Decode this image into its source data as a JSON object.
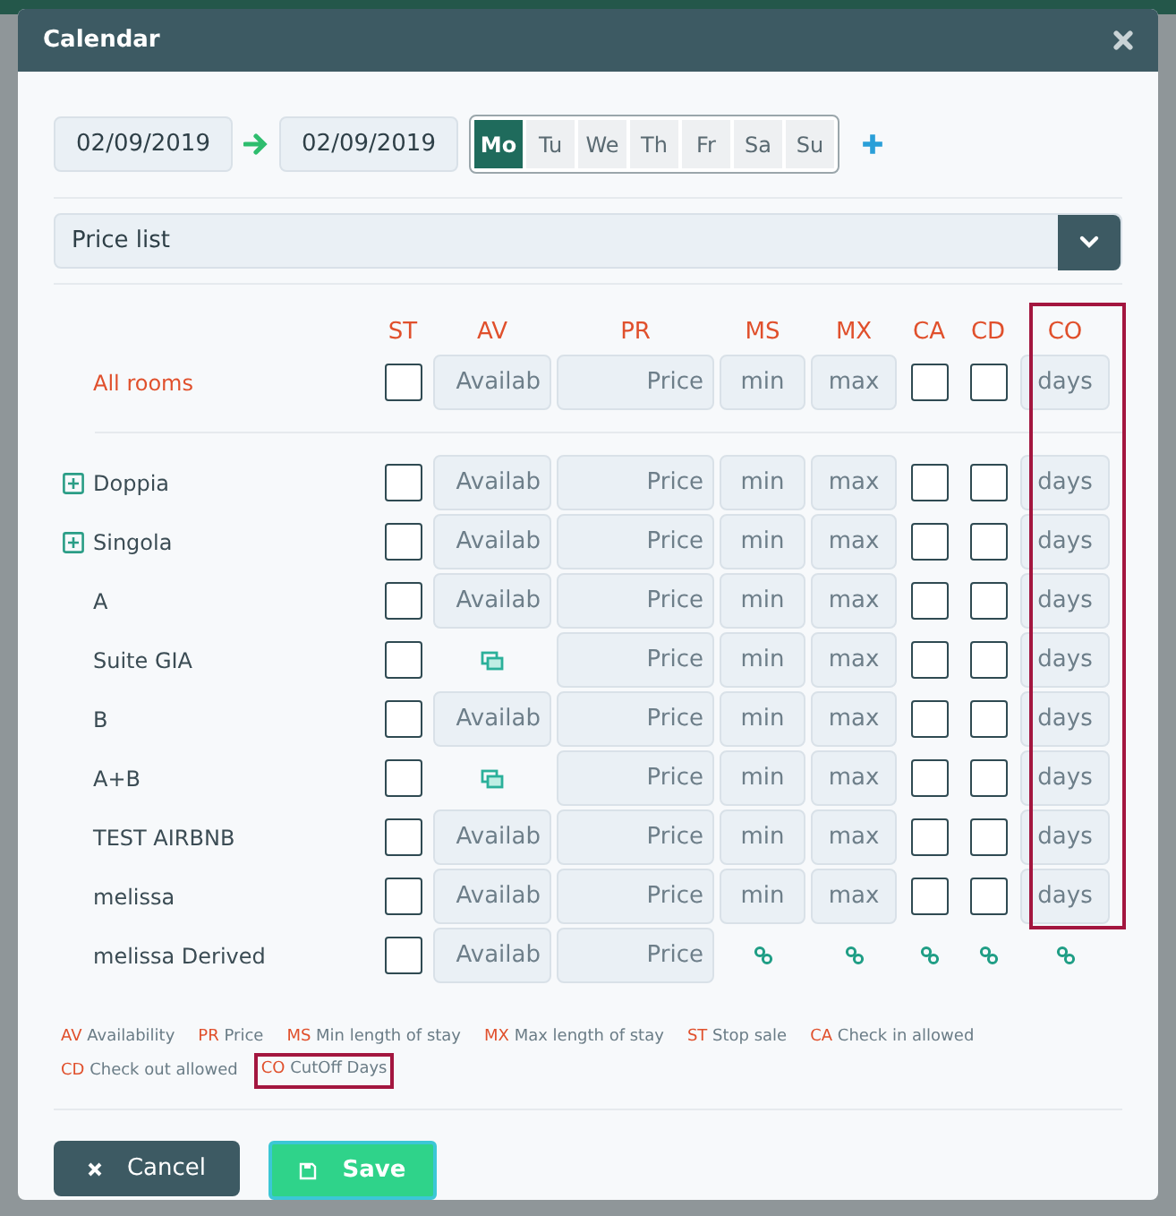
{
  "window": {
    "title": "Calendar"
  },
  "date_from": "02/09/2019",
  "date_to": "02/09/2019",
  "weekdays": [
    {
      "label": "Mo",
      "selected": true
    },
    {
      "label": "Tu",
      "selected": false
    },
    {
      "label": "We",
      "selected": false
    },
    {
      "label": "Th",
      "selected": false
    },
    {
      "label": "Fr",
      "selected": false
    },
    {
      "label": "Sa",
      "selected": false
    },
    {
      "label": "Su",
      "selected": false
    }
  ],
  "price_list": {
    "value": "Price list"
  },
  "columns": [
    {
      "label": "ST",
      "highlighted": false
    },
    {
      "label": "AV",
      "highlighted": false
    },
    {
      "label": "PR",
      "highlighted": false
    },
    {
      "label": "MS",
      "highlighted": false
    },
    {
      "label": "MX",
      "highlighted": false
    },
    {
      "label": "CA",
      "highlighted": false
    },
    {
      "label": "CD",
      "highlighted": false
    },
    {
      "label": "CO",
      "highlighted": true
    }
  ],
  "all_rooms": {
    "name": "All rooms",
    "cells": [
      {
        "kind": "checkbox",
        "checked": false
      },
      {
        "kind": "input",
        "placeholder": "Availab"
      },
      {
        "kind": "input",
        "placeholder": "Price"
      },
      {
        "kind": "input",
        "placeholder": "min"
      },
      {
        "kind": "input",
        "placeholder": "max"
      },
      {
        "kind": "checkbox",
        "checked": false
      },
      {
        "kind": "checkbox",
        "checked": false
      },
      {
        "kind": "input",
        "placeholder": "days"
      }
    ]
  },
  "rooms": [
    {
      "name": "Doppia",
      "expandable": true,
      "cells": [
        {
          "kind": "checkbox",
          "checked": false
        },
        {
          "kind": "input",
          "placeholder": "Availab"
        },
        {
          "kind": "input",
          "placeholder": "Price"
        },
        {
          "kind": "input",
          "placeholder": "min"
        },
        {
          "kind": "input",
          "placeholder": "max"
        },
        {
          "kind": "checkbox",
          "checked": false
        },
        {
          "kind": "checkbox",
          "checked": false
        },
        {
          "kind": "input",
          "placeholder": "days"
        }
      ]
    },
    {
      "name": "Singola",
      "expandable": true,
      "cells": [
        {
          "kind": "checkbox",
          "checked": false
        },
        {
          "kind": "input",
          "placeholder": "Availab"
        },
        {
          "kind": "input",
          "placeholder": "Price"
        },
        {
          "kind": "input",
          "placeholder": "min"
        },
        {
          "kind": "input",
          "placeholder": "max"
        },
        {
          "kind": "checkbox",
          "checked": false
        },
        {
          "kind": "checkbox",
          "checked": false
        },
        {
          "kind": "input",
          "placeholder": "days"
        }
      ]
    },
    {
      "name": "A",
      "expandable": false,
      "cells": [
        {
          "kind": "checkbox",
          "checked": false
        },
        {
          "kind": "input",
          "placeholder": "Availab"
        },
        {
          "kind": "input",
          "placeholder": "Price"
        },
        {
          "kind": "input",
          "placeholder": "min"
        },
        {
          "kind": "input",
          "placeholder": "max"
        },
        {
          "kind": "checkbox",
          "checked": false
        },
        {
          "kind": "checkbox",
          "checked": false
        },
        {
          "kind": "input",
          "placeholder": "days"
        }
      ]
    },
    {
      "name": "Suite GIA",
      "expandable": false,
      "cells": [
        {
          "kind": "checkbox",
          "checked": false
        },
        {
          "kind": "layers"
        },
        {
          "kind": "input",
          "placeholder": "Price"
        },
        {
          "kind": "input",
          "placeholder": "min"
        },
        {
          "kind": "input",
          "placeholder": "max"
        },
        {
          "kind": "checkbox",
          "checked": false
        },
        {
          "kind": "checkbox",
          "checked": false
        },
        {
          "kind": "input",
          "placeholder": "days"
        }
      ]
    },
    {
      "name": "B",
      "expandable": false,
      "cells": [
        {
          "kind": "checkbox",
          "checked": false
        },
        {
          "kind": "input",
          "placeholder": "Availab"
        },
        {
          "kind": "input",
          "placeholder": "Price"
        },
        {
          "kind": "input",
          "placeholder": "min"
        },
        {
          "kind": "input",
          "placeholder": "max"
        },
        {
          "kind": "checkbox",
          "checked": false
        },
        {
          "kind": "checkbox",
          "checked": false
        },
        {
          "kind": "input",
          "placeholder": "days"
        }
      ]
    },
    {
      "name": "A+B",
      "expandable": false,
      "cells": [
        {
          "kind": "checkbox",
          "checked": false
        },
        {
          "kind": "layers"
        },
        {
          "kind": "input",
          "placeholder": "Price"
        },
        {
          "kind": "input",
          "placeholder": "min"
        },
        {
          "kind": "input",
          "placeholder": "max"
        },
        {
          "kind": "checkbox",
          "checked": false
        },
        {
          "kind": "checkbox",
          "checked": false
        },
        {
          "kind": "input",
          "placeholder": "days"
        }
      ]
    },
    {
      "name": "TEST AIRBNB",
      "expandable": false,
      "cells": [
        {
          "kind": "checkbox",
          "checked": false
        },
        {
          "kind": "input",
          "placeholder": "Availab"
        },
        {
          "kind": "input",
          "placeholder": "Price"
        },
        {
          "kind": "input",
          "placeholder": "min"
        },
        {
          "kind": "input",
          "placeholder": "max"
        },
        {
          "kind": "checkbox",
          "checked": false
        },
        {
          "kind": "checkbox",
          "checked": false
        },
        {
          "kind": "input",
          "placeholder": "days"
        }
      ]
    },
    {
      "name": "melissa",
      "expandable": false,
      "cells": [
        {
          "kind": "checkbox",
          "checked": false
        },
        {
          "kind": "input",
          "placeholder": "Availab"
        },
        {
          "kind": "input",
          "placeholder": "Price"
        },
        {
          "kind": "input",
          "placeholder": "min"
        },
        {
          "kind": "input",
          "placeholder": "max"
        },
        {
          "kind": "checkbox",
          "checked": false
        },
        {
          "kind": "checkbox",
          "checked": false
        },
        {
          "kind": "input",
          "placeholder": "days"
        }
      ]
    },
    {
      "name": "melissa Derived",
      "expandable": false,
      "cells": [
        {
          "kind": "checkbox",
          "checked": false
        },
        {
          "kind": "input",
          "placeholder": "Availab"
        },
        {
          "kind": "input",
          "placeholder": "Price"
        },
        {
          "kind": "linked"
        },
        {
          "kind": "linked"
        },
        {
          "kind": "linked"
        },
        {
          "kind": "linked"
        },
        {
          "kind": "linked"
        }
      ]
    }
  ],
  "legend": [
    {
      "abbr": "AV",
      "text": "Availability",
      "highlighted": false
    },
    {
      "abbr": "PR",
      "text": "Price",
      "highlighted": false
    },
    {
      "abbr": "MS",
      "text": "Min length of stay",
      "highlighted": false
    },
    {
      "abbr": "MX",
      "text": "Max length of stay",
      "highlighted": false
    },
    {
      "abbr": "ST",
      "text": "Stop sale",
      "highlighted": false
    },
    {
      "abbr": "CA",
      "text": "Check in allowed",
      "highlighted": false
    },
    {
      "abbr": "CD",
      "text": "Check out allowed",
      "highlighted": false
    },
    {
      "abbr": "CO",
      "text": "CutOff Days",
      "highlighted": true
    }
  ],
  "buttons": [
    {
      "label": "Cancel",
      "kind": "cancel"
    },
    {
      "label": "Save",
      "kind": "save"
    }
  ]
}
